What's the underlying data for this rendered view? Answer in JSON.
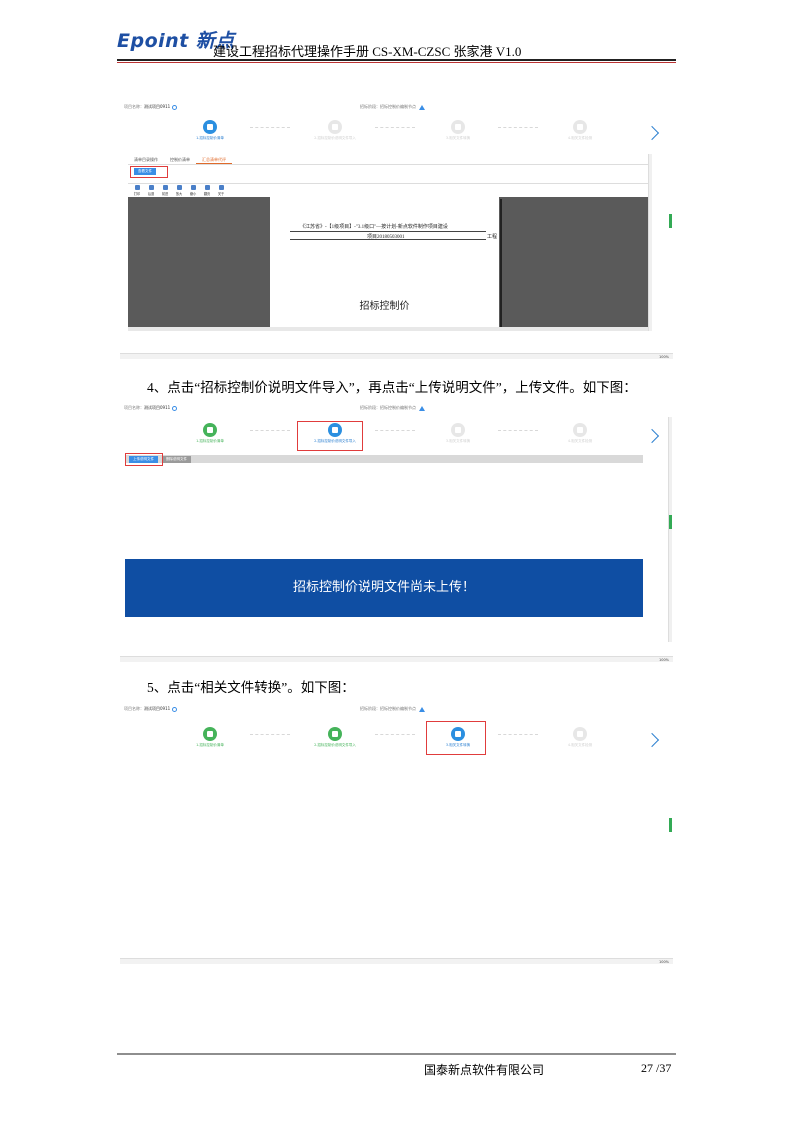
{
  "header": {
    "logo_text": "Epoint 新点",
    "doc_title": "建设工程招标代理操作手册 CS-XM-CZSC 张家港 V1.0"
  },
  "screenshot1": {
    "project_label": "项目名称：",
    "project_value": "测试项目0911",
    "mid_label": "招标阶段：",
    "mid_value": "招标控制价编制节点",
    "steps": [
      {
        "label": "1.招标控制价清单",
        "state": "active"
      },
      {
        "label": "2.招标控制价说明文件导入",
        "state": "todo"
      },
      {
        "label": "3.相关文件转换",
        "state": "todo"
      },
      {
        "label": "4.相关文件检测",
        "state": "todo"
      }
    ],
    "tabs": [
      {
        "label": "清单目录操作",
        "active": false
      },
      {
        "label": "控制价清单",
        "active": false
      },
      {
        "label": "汇总清单代评",
        "active": true
      }
    ],
    "action_button": "查看文件",
    "toolbar": [
      "打印",
      "后退",
      "前进",
      "放大",
      "缩小",
      "翻页",
      "关于"
    ],
    "doc_line1": "《江苏省》-【1级项目】-\"3.1级口\"—按计划-新点软件制作项目建设",
    "doc_line2": "项目20180503001",
    "doc_line3": "工程",
    "doc_big": "招标控制价",
    "zoom": "100%"
  },
  "instruction4": "4、点击“招标控制价说明文件导入”，再点击“上传说明文件”，上传文件。如下图：",
  "screenshot2": {
    "project_label": "项目名称：",
    "project_value": "测试项目0911",
    "mid_label": "招标阶段：",
    "mid_value": "招标控制价编制节点",
    "steps": [
      {
        "label": "1.招标控制价清单",
        "state": "done"
      },
      {
        "label": "2.招标控制价说明文件导入",
        "state": "active"
      },
      {
        "label": "3.相关文件转换",
        "state": "todo"
      },
      {
        "label": "4.相关文件检测",
        "state": "todo"
      }
    ],
    "upload_button": "上传说明文件",
    "delete_button": "删除说明文件",
    "banner": "招标控制价说明文件尚未上传！",
    "zoom": "100%"
  },
  "instruction5": "5、点击“相关文件转换”。如下图：",
  "screenshot3": {
    "project_label": "项目名称：",
    "project_value": "测试项目0911",
    "mid_label": "招标阶段：",
    "mid_value": "招标控制价编制节点",
    "steps": [
      {
        "label": "1.招标控制价清单",
        "state": "done"
      },
      {
        "label": "2.招标控制价说明文件导入",
        "state": "done"
      },
      {
        "label": "3.相关文件转换",
        "state": "active"
      },
      {
        "label": "4.相关文件检测",
        "state": "todo"
      }
    ],
    "zoom": "100%"
  },
  "footer": {
    "company": "国泰新点软件有限公司",
    "page": "27 /37"
  },
  "colors": {
    "accent_blue": "#2b8fe0",
    "done_green": "#45b35a",
    "banner_blue": "#0f4ea3",
    "highlight_red": "#e03c3c"
  }
}
